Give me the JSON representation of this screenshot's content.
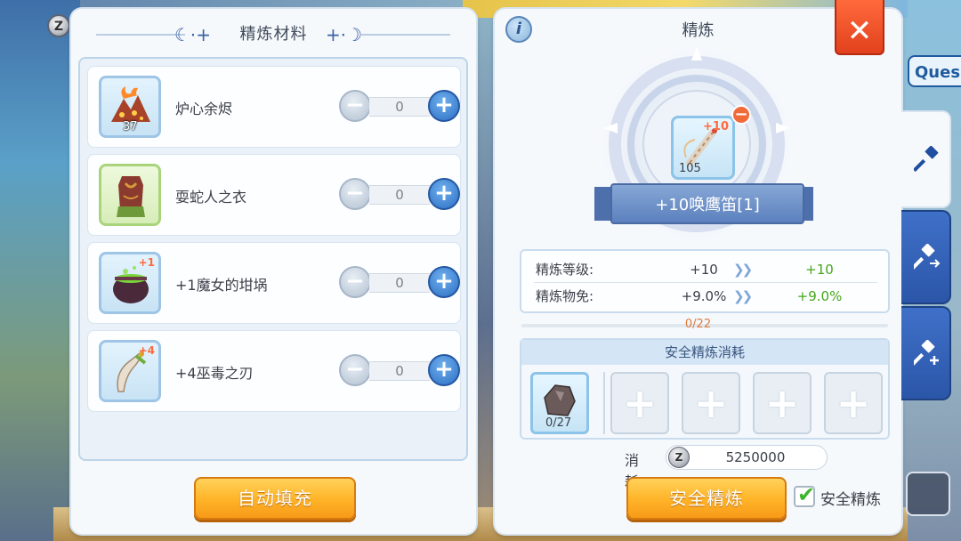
{
  "left_panel": {
    "title": "精炼材料",
    "coin_icon": "zeny-coin-icon",
    "materials": [
      {
        "name": "炉心余烬",
        "count": "37",
        "plus": "",
        "qty": "0",
        "icon": "ember-pile-icon"
      },
      {
        "name": "耍蛇人之衣",
        "count": "",
        "plus": "",
        "qty": "0",
        "icon": "snake-charmer-robe-icon"
      },
      {
        "name": "+1魔女的坩埚",
        "count": "",
        "plus": "+1",
        "qty": "0",
        "icon": "witch-cauldron-icon"
      },
      {
        "name": "+4巫毒之刃",
        "count": "",
        "plus": "+4",
        "qty": "0",
        "icon": "voodoo-blade-icon"
      }
    ],
    "auto_fill_label": "自动填充"
  },
  "right_panel": {
    "title": "精炼",
    "item": {
      "name": "+10唤鹰笛[1]",
      "level": "+10",
      "count": "105",
      "icon": "hawk-whistle-icon"
    },
    "stats": [
      {
        "label": "精炼等级:",
        "from": "+10",
        "to": "+10"
      },
      {
        "label": "精炼物免:",
        "from": "+9.0%",
        "to": "+9.0%"
      }
    ],
    "progress": {
      "text": "0/22",
      "fraction": 0
    },
    "safe": {
      "header": "安全精炼消耗",
      "slot_count": "0/27"
    },
    "cost": {
      "label": "消耗:",
      "value": "5250000"
    },
    "safe_refine_label": "安全精炼",
    "safe_check_label": "安全精炼"
  },
  "background": {
    "quest_label": "Ques"
  }
}
